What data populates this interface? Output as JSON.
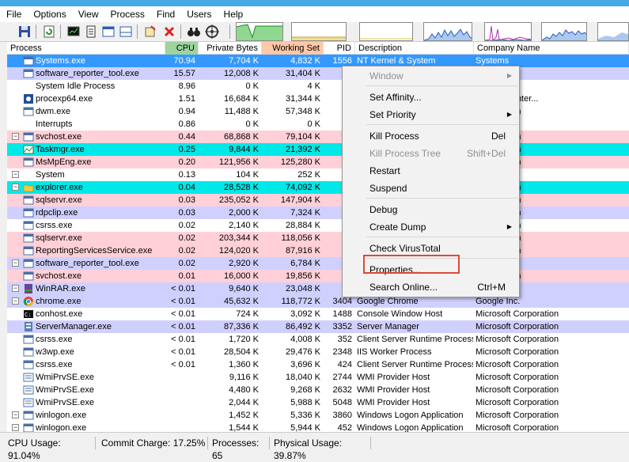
{
  "menubar": {
    "items": [
      "File",
      "Options",
      "View",
      "Process",
      "Find",
      "Users",
      "Help"
    ]
  },
  "columns": {
    "process": "Process",
    "cpu": "CPU",
    "private_bytes": "Private Bytes",
    "working_set": "Working Set",
    "pid": "PID",
    "description": "Description",
    "company": "Company Name"
  },
  "colors": {
    "accent": "#49a9e4",
    "selected": "#3399ff",
    "service": "#ffd0d8",
    "own": "#d0d0ff",
    "immersive": "#00e8e8",
    "cpu_header": "#9ed39e",
    "ws_header": "#ffc8a8",
    "highlight_box": "#e0473b"
  },
  "rows": [
    {
      "name": "Systems.exe",
      "cpu": "70.94",
      "priv": "7,704 K",
      "ws": "4,832 K",
      "pid": "1556",
      "desc": "NT Kernel & System",
      "comp": "Systems",
      "bg": "selected",
      "icon": "process-generic-icon",
      "expander": ""
    },
    {
      "name": "software_reporter_tool.exe",
      "cpu": "15.57",
      "priv": "12,008 K",
      "ws": "31,404 K",
      "pid": "",
      "desc": "",
      "comp": "",
      "bg": "own",
      "icon": "process-generic-icon",
      "expander": ""
    },
    {
      "name": "System Idle Process",
      "cpu": "8.96",
      "priv": "0 K",
      "ws": "4 K",
      "pid": "",
      "desc": "",
      "comp": "",
      "bg": "",
      "icon": "none",
      "expander": ""
    },
    {
      "name": "procexp64.exe",
      "cpu": "1.51",
      "priv": "16,684 K",
      "ws": "31,344 K",
      "pid": "4!",
      "desc": "",
      "comp": "- www.sysinter...",
      "bg": "",
      "icon": "procexp-icon",
      "expander": ""
    },
    {
      "name": "dwm.exe",
      "cpu": "0.94",
      "priv": "11,488 K",
      "ws": "57,348 K",
      "pid": "",
      "desc": "",
      "comp": "Corporation",
      "bg": "",
      "icon": "process-generic-icon",
      "expander": ""
    },
    {
      "name": "Interrupts",
      "cpu": "0.86",
      "priv": "0 K",
      "ws": "0 K",
      "pid": "",
      "desc": "",
      "comp": "",
      "bg": "",
      "icon": "none",
      "expander": ""
    },
    {
      "name": "svchost.exe",
      "cpu": "0.44",
      "priv": "68,868 K",
      "ws": "79,104 K",
      "pid": "2i",
      "desc": "",
      "comp": "Corporation",
      "bg": "service",
      "icon": "process-generic-icon",
      "expander": "−"
    },
    {
      "name": "Taskmgr.exe",
      "cpu": "0.25",
      "priv": "9,844 K",
      "ws": "21,392 K",
      "pid": "3",
      "desc": "",
      "comp": "Corporation",
      "bg": "immersive",
      "icon": "taskmgr-icon",
      "expander": ""
    },
    {
      "name": "MsMpEng.exe",
      "cpu": "0.20",
      "priv": "121,956 K",
      "ws": "125,280 K",
      "pid": "",
      "desc": "",
      "comp": "Corporation",
      "bg": "service",
      "icon": "process-generic-icon",
      "expander": ""
    },
    {
      "name": "System",
      "cpu": "0.13",
      "priv": "104 K",
      "ws": "252 K",
      "pid": "",
      "desc": "",
      "comp": "",
      "bg": "",
      "icon": "none",
      "expander": "−"
    },
    {
      "name": "explorer.exe",
      "cpu": "0.04",
      "priv": "28,528 K",
      "ws": "74,092 K",
      "pid": "3:",
      "desc": "",
      "comp": "Corporation",
      "bg": "immersive",
      "icon": "folder-icon",
      "expander": "−"
    },
    {
      "name": "sqlservr.exe",
      "cpu": "0.03",
      "priv": "235,052 K",
      "ws": "147,904 K",
      "pid": "1:",
      "desc": "",
      "comp": "Corporation",
      "bg": "service",
      "icon": "process-generic-icon",
      "expander": ""
    },
    {
      "name": "rdpclip.exe",
      "cpu": "0.03",
      "priv": "2,000 K",
      "ws": "7,324 K",
      "pid": "3:",
      "desc": "",
      "comp": "Corporation",
      "bg": "own",
      "icon": "process-generic-icon",
      "expander": ""
    },
    {
      "name": "csrss.exe",
      "cpu": "0.02",
      "priv": "2,140 K",
      "ws": "28,884 K",
      "pid": "3:",
      "desc": "",
      "comp": "Corporation",
      "bg": "",
      "icon": "process-generic-icon",
      "expander": ""
    },
    {
      "name": "sqlservr.exe",
      "cpu": "0.02",
      "priv": "203,344 K",
      "ws": "118,056 K",
      "pid": "1:",
      "desc": "",
      "comp": "Corporation",
      "bg": "service",
      "icon": "process-generic-icon",
      "expander": ""
    },
    {
      "name": "ReportingServicesService.exe",
      "cpu": "0.02",
      "priv": "124,020 K",
      "ws": "87,916 K",
      "pid": "1(",
      "desc": "",
      "comp": "Corporation",
      "bg": "service",
      "icon": "process-generic-icon",
      "expander": ""
    },
    {
      "name": "software_reporter_tool.exe",
      "cpu": "0.02",
      "priv": "2,920 K",
      "ws": "6,784 K",
      "pid": "4!",
      "desc": "",
      "comp": "",
      "bg": "own",
      "icon": "process-generic-icon",
      "expander": "−"
    },
    {
      "name": "svchost.exe",
      "cpu": "0.01",
      "priv": "16,000 K",
      "ws": "19,856 K",
      "pid": "8!",
      "desc": "",
      "comp": "Corporation",
      "bg": "service",
      "icon": "process-generic-icon",
      "expander": ""
    },
    {
      "name": "WinRAR.exe",
      "cpu": "< 0.01",
      "priv": "9,640 K",
      "ws": "23,048 K",
      "pid": "4!",
      "desc": "",
      "comp": "oshal",
      "bg": "own",
      "icon": "winrar-icon",
      "expander": "−"
    },
    {
      "name": "chrome.exe",
      "cpu": "< 0.01",
      "priv": "45,632 K",
      "ws": "118,772 K",
      "pid": "3404",
      "desc": "Google Chrome",
      "comp": "Google Inc.",
      "bg": "own",
      "icon": "chrome-icon",
      "expander": "−"
    },
    {
      "name": "conhost.exe",
      "cpu": "< 0.01",
      "priv": "724 K",
      "ws": "3,092 K",
      "pid": "1488",
      "desc": "Console Window Host",
      "comp": "Microsoft Corporation",
      "bg": "",
      "icon": "console-icon",
      "expander": ""
    },
    {
      "name": "ServerManager.exe",
      "cpu": "< 0.01",
      "priv": "87,336 K",
      "ws": "86,492 K",
      "pid": "3352",
      "desc": "Server Manager",
      "comp": "Microsoft Corporation",
      "bg": "own",
      "icon": "server-manager-icon",
      "expander": ""
    },
    {
      "name": "csrss.exe",
      "cpu": "< 0.01",
      "priv": "1,720 K",
      "ws": "4,008 K",
      "pid": "352",
      "desc": "Client Server Runtime Process",
      "comp": "Microsoft Corporation",
      "bg": "",
      "icon": "process-generic-icon",
      "expander": ""
    },
    {
      "name": "w3wp.exe",
      "cpu": "< 0.01",
      "priv": "28,504 K",
      "ws": "29,476 K",
      "pid": "2348",
      "desc": "IIS Worker Process",
      "comp": "Microsoft Corporation",
      "bg": "",
      "icon": "process-generic-icon",
      "expander": ""
    },
    {
      "name": "csrss.exe",
      "cpu": "< 0.01",
      "priv": "1,360 K",
      "ws": "3,696 K",
      "pid": "424",
      "desc": "Client Server Runtime Process",
      "comp": "Microsoft Corporation",
      "bg": "",
      "icon": "process-generic-icon",
      "expander": ""
    },
    {
      "name": "WmiPrvSE.exe",
      "cpu": "",
      "priv": "9,116 K",
      "ws": "18,040 K",
      "pid": "2744",
      "desc": "WMI Provider Host",
      "comp": "Microsoft Corporation",
      "bg": "",
      "icon": "wmi-icon",
      "expander": ""
    },
    {
      "name": "WmiPrvSE.exe",
      "cpu": "",
      "priv": "4,480 K",
      "ws": "9,268 K",
      "pid": "2632",
      "desc": "WMI Provider Host",
      "comp": "Microsoft Corporation",
      "bg": "",
      "icon": "wmi-icon",
      "expander": ""
    },
    {
      "name": "WmiPrvSE.exe",
      "cpu": "",
      "priv": "2,044 K",
      "ws": "5,988 K",
      "pid": "5048",
      "desc": "WMI Provider Host",
      "comp": "Microsoft Corporation",
      "bg": "",
      "icon": "wmi-icon",
      "expander": ""
    },
    {
      "name": "winlogon.exe",
      "cpu": "",
      "priv": "1,452 K",
      "ws": "5,336 K",
      "pid": "3860",
      "desc": "Windows Logon Application",
      "comp": "Microsoft Corporation",
      "bg": "",
      "icon": "process-generic-icon",
      "expander": "−"
    },
    {
      "name": "winlogon.exe",
      "cpu": "",
      "priv": "1,544 K",
      "ws": "5,944 K",
      "pid": "452",
      "desc": "Windows Logon Application",
      "comp": "Microsoft Corporation",
      "bg": "",
      "icon": "process-generic-icon",
      "expander": "−"
    }
  ],
  "context_menu": [
    {
      "label": "Window",
      "shortcut": "",
      "submenu": true,
      "disabled": true
    },
    {
      "sep": true
    },
    {
      "label": "Set Affinity...",
      "shortcut": "",
      "submenu": false,
      "disabled": false
    },
    {
      "label": "Set Priority",
      "shortcut": "",
      "submenu": true,
      "disabled": false
    },
    {
      "sep": true
    },
    {
      "label": "Kill Process",
      "shortcut": "Del",
      "submenu": false,
      "disabled": false
    },
    {
      "label": "Kill Process Tree",
      "shortcut": "Shift+Del",
      "submenu": false,
      "disabled": true
    },
    {
      "label": "Restart",
      "shortcut": "",
      "submenu": false,
      "disabled": false
    },
    {
      "label": "Suspend",
      "shortcut": "",
      "submenu": false,
      "disabled": false
    },
    {
      "sep": true
    },
    {
      "label": "Debug",
      "shortcut": "",
      "submenu": false,
      "disabled": false
    },
    {
      "label": "Create Dump",
      "shortcut": "",
      "submenu": true,
      "disabled": false
    },
    {
      "sep": true
    },
    {
      "label": "Check VirusTotal",
      "shortcut": "",
      "submenu": false,
      "disabled": false
    },
    {
      "sep": true
    },
    {
      "label": "Properties...",
      "shortcut": "",
      "submenu": false,
      "disabled": false
    },
    {
      "label": "Search Online...",
      "shortcut": "Ctrl+M",
      "submenu": false,
      "disabled": false
    }
  ],
  "status": {
    "cpu": "CPU Usage: 91.04%",
    "commit": "Commit Charge: 17.25%",
    "processes": "Processes: 65",
    "physical": "Physical Usage: 39.87%"
  }
}
